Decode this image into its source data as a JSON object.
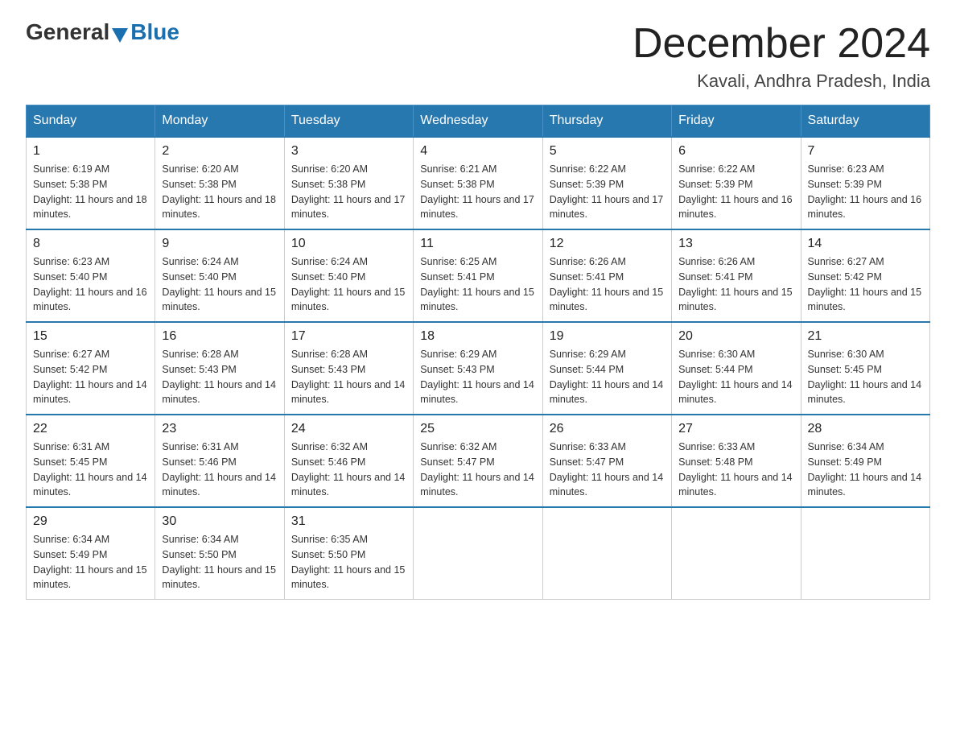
{
  "header": {
    "logo_general": "General",
    "logo_blue": "Blue",
    "month_title": "December 2024",
    "location": "Kavali, Andhra Pradesh, India"
  },
  "days_of_week": [
    "Sunday",
    "Monday",
    "Tuesday",
    "Wednesday",
    "Thursday",
    "Friday",
    "Saturday"
  ],
  "weeks": [
    [
      {
        "num": "1",
        "sunrise": "6:19 AM",
        "sunset": "5:38 PM",
        "daylight": "11 hours and 18 minutes."
      },
      {
        "num": "2",
        "sunrise": "6:20 AM",
        "sunset": "5:38 PM",
        "daylight": "11 hours and 18 minutes."
      },
      {
        "num": "3",
        "sunrise": "6:20 AM",
        "sunset": "5:38 PM",
        "daylight": "11 hours and 17 minutes."
      },
      {
        "num": "4",
        "sunrise": "6:21 AM",
        "sunset": "5:38 PM",
        "daylight": "11 hours and 17 minutes."
      },
      {
        "num": "5",
        "sunrise": "6:22 AM",
        "sunset": "5:39 PM",
        "daylight": "11 hours and 17 minutes."
      },
      {
        "num": "6",
        "sunrise": "6:22 AM",
        "sunset": "5:39 PM",
        "daylight": "11 hours and 16 minutes."
      },
      {
        "num": "7",
        "sunrise": "6:23 AM",
        "sunset": "5:39 PM",
        "daylight": "11 hours and 16 minutes."
      }
    ],
    [
      {
        "num": "8",
        "sunrise": "6:23 AM",
        "sunset": "5:40 PM",
        "daylight": "11 hours and 16 minutes."
      },
      {
        "num": "9",
        "sunrise": "6:24 AM",
        "sunset": "5:40 PM",
        "daylight": "11 hours and 15 minutes."
      },
      {
        "num": "10",
        "sunrise": "6:24 AM",
        "sunset": "5:40 PM",
        "daylight": "11 hours and 15 minutes."
      },
      {
        "num": "11",
        "sunrise": "6:25 AM",
        "sunset": "5:41 PM",
        "daylight": "11 hours and 15 minutes."
      },
      {
        "num": "12",
        "sunrise": "6:26 AM",
        "sunset": "5:41 PM",
        "daylight": "11 hours and 15 minutes."
      },
      {
        "num": "13",
        "sunrise": "6:26 AM",
        "sunset": "5:41 PM",
        "daylight": "11 hours and 15 minutes."
      },
      {
        "num": "14",
        "sunrise": "6:27 AM",
        "sunset": "5:42 PM",
        "daylight": "11 hours and 15 minutes."
      }
    ],
    [
      {
        "num": "15",
        "sunrise": "6:27 AM",
        "sunset": "5:42 PM",
        "daylight": "11 hours and 14 minutes."
      },
      {
        "num": "16",
        "sunrise": "6:28 AM",
        "sunset": "5:43 PM",
        "daylight": "11 hours and 14 minutes."
      },
      {
        "num": "17",
        "sunrise": "6:28 AM",
        "sunset": "5:43 PM",
        "daylight": "11 hours and 14 minutes."
      },
      {
        "num": "18",
        "sunrise": "6:29 AM",
        "sunset": "5:43 PM",
        "daylight": "11 hours and 14 minutes."
      },
      {
        "num": "19",
        "sunrise": "6:29 AM",
        "sunset": "5:44 PM",
        "daylight": "11 hours and 14 minutes."
      },
      {
        "num": "20",
        "sunrise": "6:30 AM",
        "sunset": "5:44 PM",
        "daylight": "11 hours and 14 minutes."
      },
      {
        "num": "21",
        "sunrise": "6:30 AM",
        "sunset": "5:45 PM",
        "daylight": "11 hours and 14 minutes."
      }
    ],
    [
      {
        "num": "22",
        "sunrise": "6:31 AM",
        "sunset": "5:45 PM",
        "daylight": "11 hours and 14 minutes."
      },
      {
        "num": "23",
        "sunrise": "6:31 AM",
        "sunset": "5:46 PM",
        "daylight": "11 hours and 14 minutes."
      },
      {
        "num": "24",
        "sunrise": "6:32 AM",
        "sunset": "5:46 PM",
        "daylight": "11 hours and 14 minutes."
      },
      {
        "num": "25",
        "sunrise": "6:32 AM",
        "sunset": "5:47 PM",
        "daylight": "11 hours and 14 minutes."
      },
      {
        "num": "26",
        "sunrise": "6:33 AM",
        "sunset": "5:47 PM",
        "daylight": "11 hours and 14 minutes."
      },
      {
        "num": "27",
        "sunrise": "6:33 AM",
        "sunset": "5:48 PM",
        "daylight": "11 hours and 14 minutes."
      },
      {
        "num": "28",
        "sunrise": "6:34 AM",
        "sunset": "5:49 PM",
        "daylight": "11 hours and 14 minutes."
      }
    ],
    [
      {
        "num": "29",
        "sunrise": "6:34 AM",
        "sunset": "5:49 PM",
        "daylight": "11 hours and 15 minutes."
      },
      {
        "num": "30",
        "sunrise": "6:34 AM",
        "sunset": "5:50 PM",
        "daylight": "11 hours and 15 minutes."
      },
      {
        "num": "31",
        "sunrise": "6:35 AM",
        "sunset": "5:50 PM",
        "daylight": "11 hours and 15 minutes."
      },
      null,
      null,
      null,
      null
    ]
  ]
}
